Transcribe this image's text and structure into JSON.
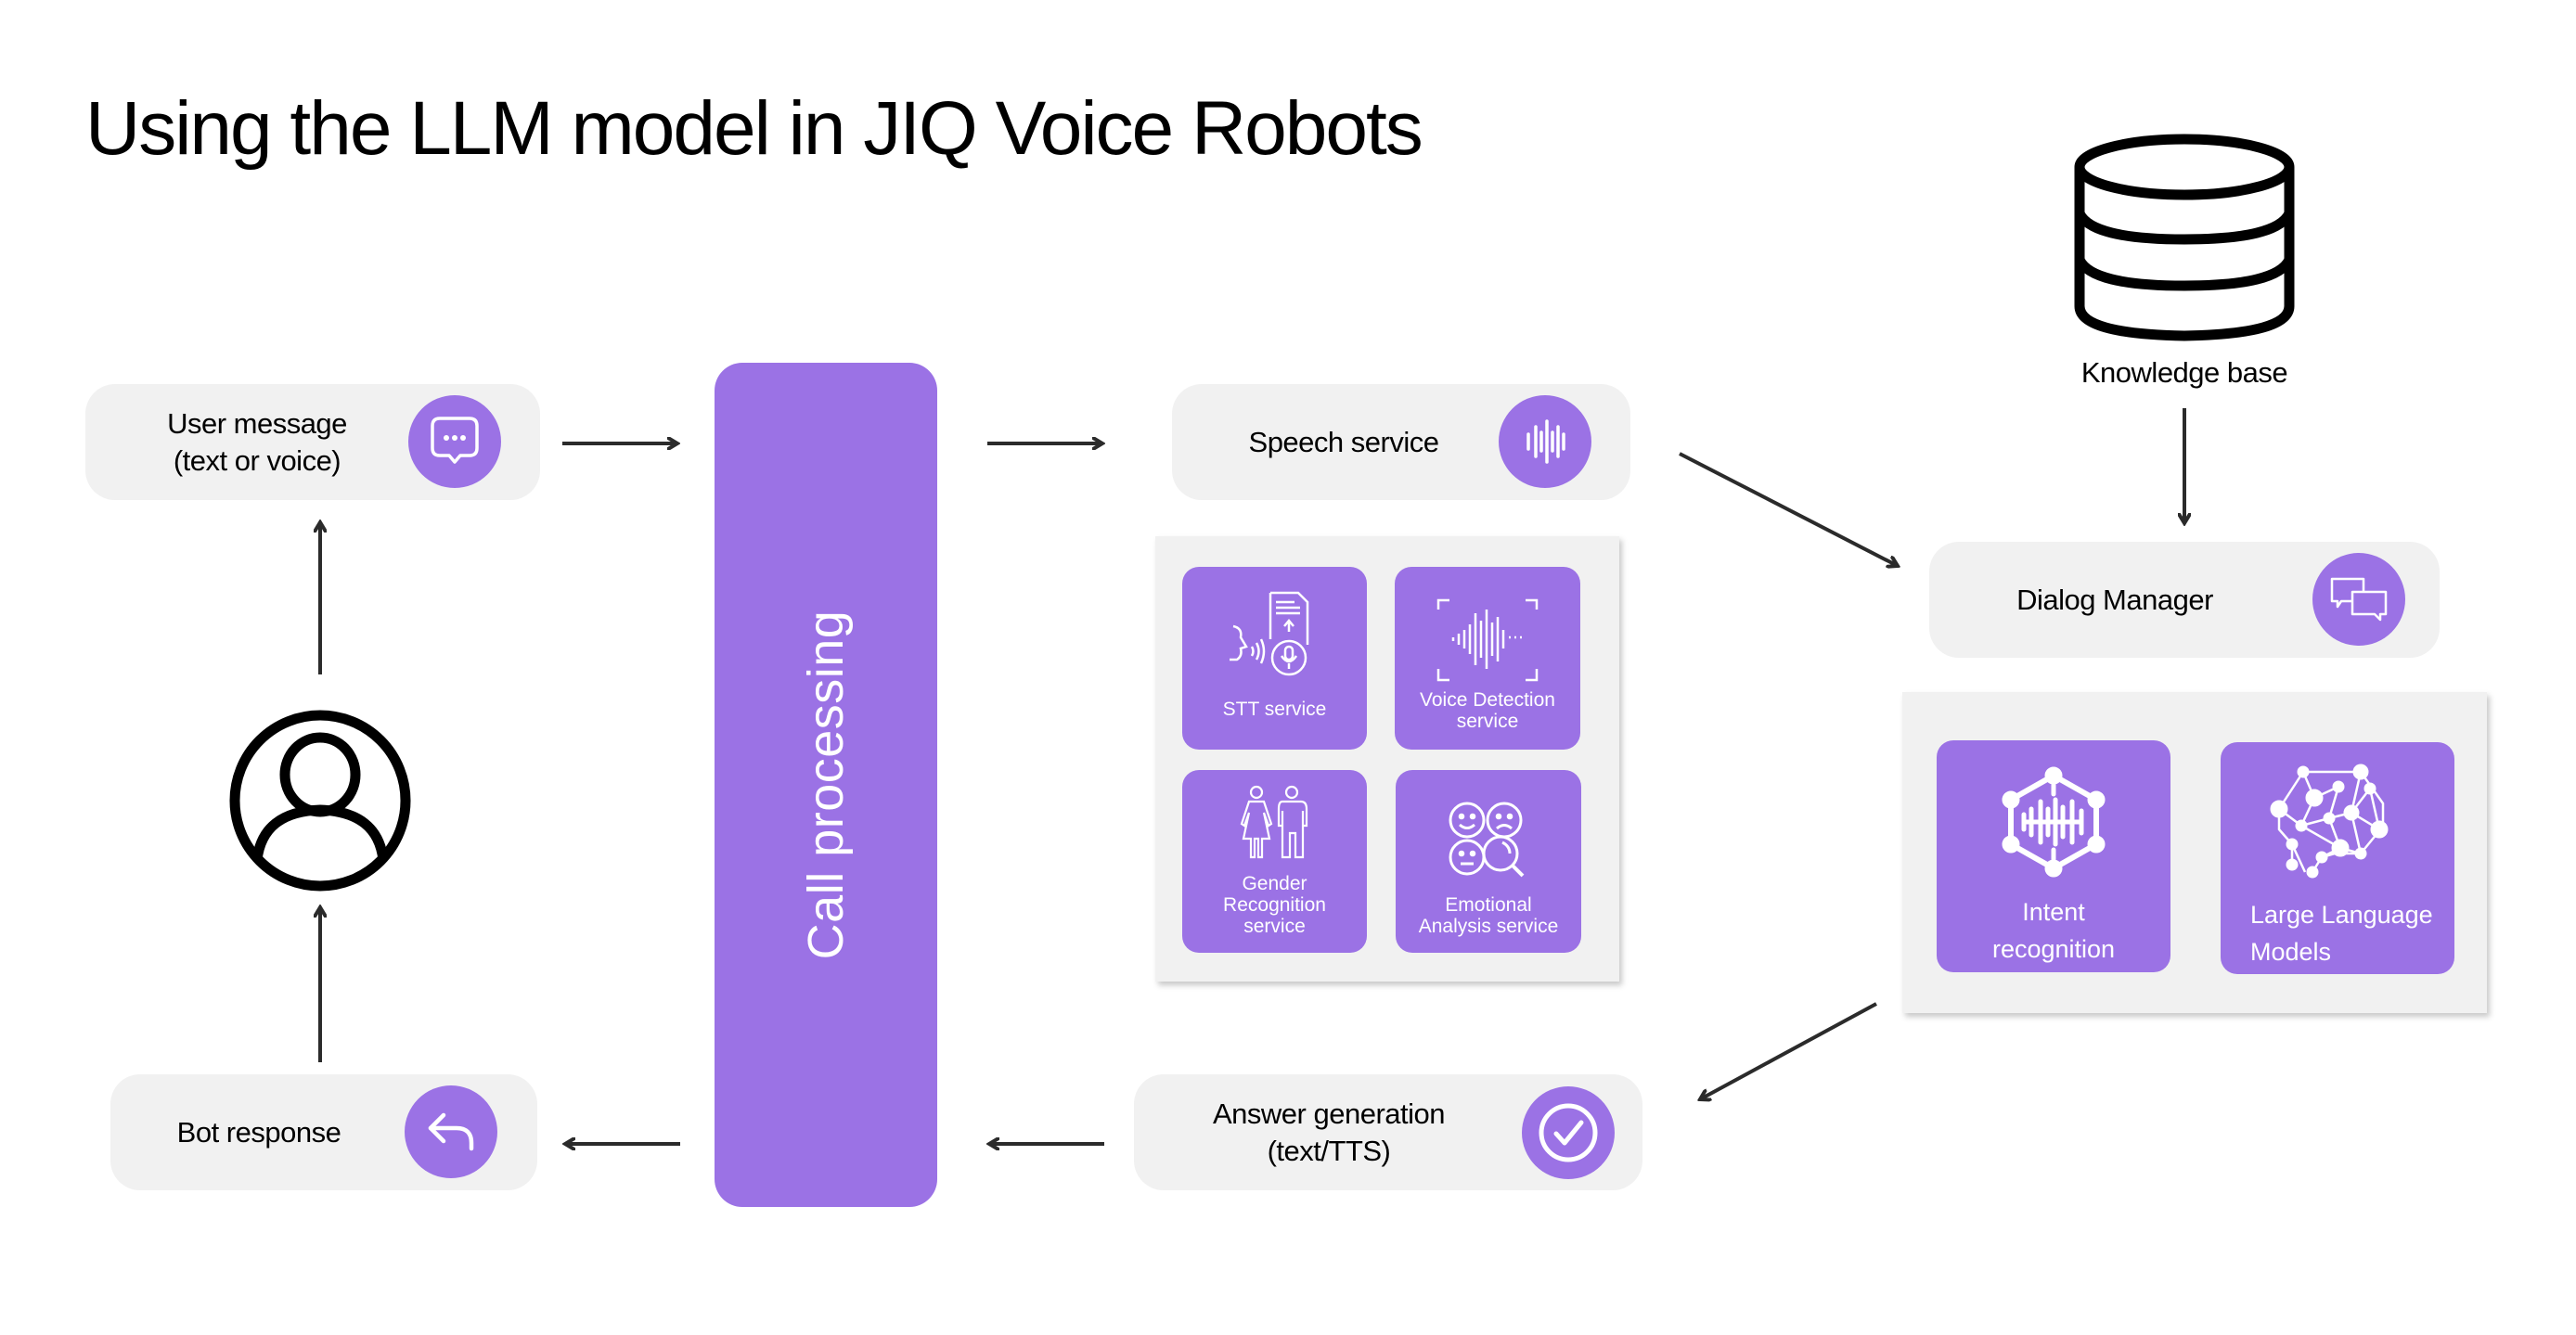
{
  "title": "Using the LLM model in JIQ Voice Robots",
  "accent_color": "#9b72e5",
  "node_bg_color": "#f1f1f1",
  "nodes": {
    "user_message": {
      "line1": "User message",
      "line2": "(text or voice)",
      "icon": "chat-bubble-icon"
    },
    "bot_response": {
      "label": "Bot response",
      "icon": "reply-icon"
    },
    "user": {
      "icon": "user-avatar-icon"
    },
    "call_processing": {
      "label": "Call processing"
    },
    "speech_service": {
      "label": "Speech service",
      "icon": "soundwave-icon"
    },
    "answer_generation": {
      "line1": "Answer generation",
      "line2": "(text/TTS)",
      "icon": "checkmark-circle-icon"
    },
    "knowledge_base": {
      "label": "Knowledge base",
      "icon": "database-icon"
    },
    "dialog_manager": {
      "label": "Dialog Manager",
      "icon": "dialog-bubbles-icon"
    }
  },
  "speech_services": [
    {
      "line1": "STT service",
      "line2": "",
      "line3": "",
      "icon": "speech-to-text-icon"
    },
    {
      "line1": "Voice Detection",
      "line2": "service",
      "line3": "",
      "icon": "voice-detection-icon"
    },
    {
      "line1": "Gender",
      "line2": "Recognition",
      "line3": "service",
      "icon": "gender-icon"
    },
    {
      "line1": "Emotional",
      "line2": "Analysis service",
      "line3": "",
      "icon": "emotion-analysis-icon"
    }
  ],
  "dialog_components": [
    {
      "line1": "Intent",
      "line2": "recognition",
      "icon": "intent-recognition-icon"
    },
    {
      "line1": "Large Language",
      "line2": "Models",
      "icon": "neural-brain-icon"
    }
  ],
  "connections": [
    {
      "from": "User message",
      "to": "Call processing"
    },
    {
      "from": "Call processing",
      "to": "Speech service"
    },
    {
      "from": "Speech service",
      "to": "Dialog Manager"
    },
    {
      "from": "Knowledge base",
      "to": "Dialog Manager"
    },
    {
      "from": "Dialog Manager",
      "to": "Answer generation"
    },
    {
      "from": "Answer generation",
      "to": "Call processing"
    },
    {
      "from": "Call processing",
      "to": "Bot response"
    },
    {
      "from": "Bot response",
      "to": "User"
    },
    {
      "from": "User",
      "to": "User message"
    }
  ]
}
